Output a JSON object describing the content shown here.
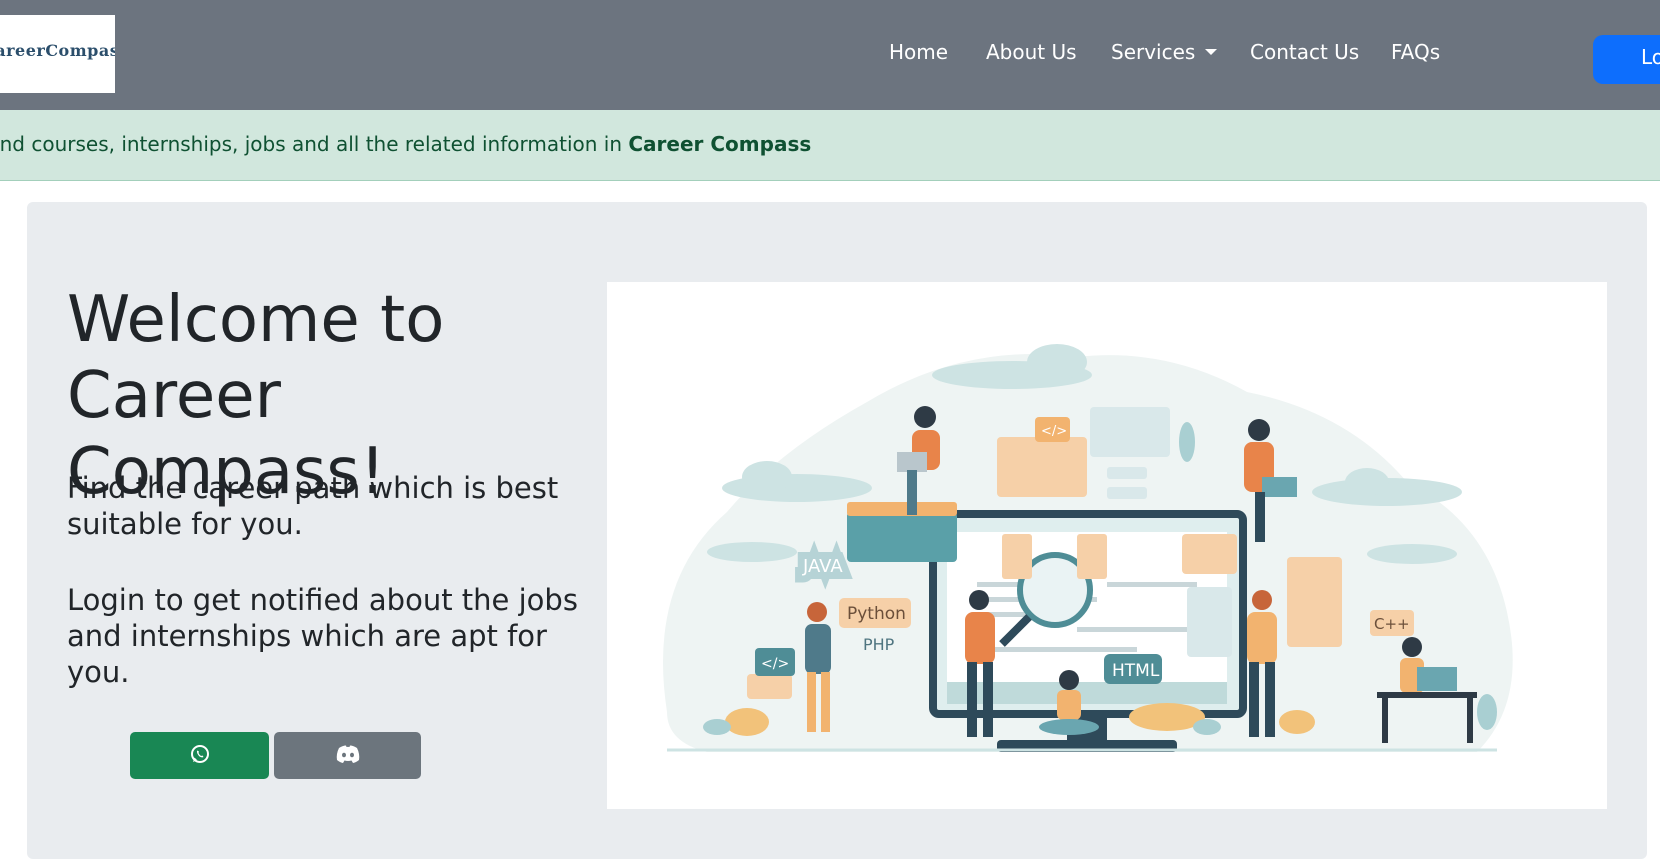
{
  "navbar": {
    "logo_text": "CareerCompass",
    "links": [
      {
        "label": "Home"
      },
      {
        "label": "About Us"
      },
      {
        "label": "Services"
      },
      {
        "label": "Contact Us"
      },
      {
        "label": "FAQs"
      }
    ],
    "login_label": "Login"
  },
  "alert": {
    "text": "Find courses, internships, jobs and all the related information in ",
    "brand": "Career Compass"
  },
  "hero": {
    "title": "Welcome to Career Compass!",
    "lead1": "Find the career path which is best suitable for you.",
    "lead2": "Login to get notified about the jobs and internships which are apt for you.",
    "whatsapp_icon": "whatsapp-icon",
    "discord_icon": "discord-icon"
  },
  "illustration": {
    "tags": [
      "JAVA",
      "Python",
      "PHP",
      "HTML",
      "C++",
      "</>",
      "</>"
    ]
  },
  "colors": {
    "navbar": "#6c747f",
    "login": "#0d6efd",
    "alert_bg": "#d1e7dd",
    "alert_text": "#0f5132",
    "hero_bg": "#e9ecef",
    "whatsapp": "#198754",
    "discord": "#6c757d"
  }
}
